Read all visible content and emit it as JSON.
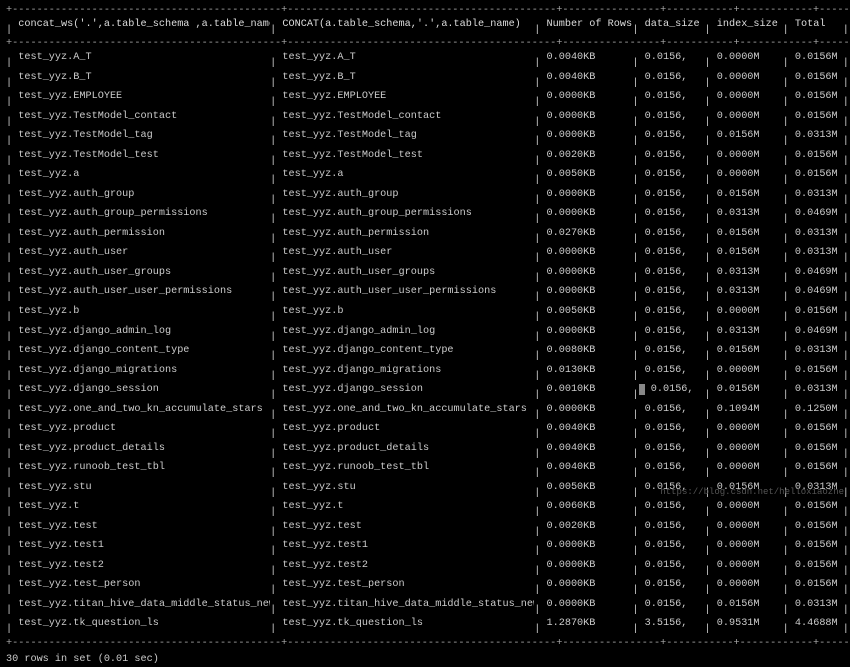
{
  "headers": {
    "col0": "concat_ws('.',a.table_schema ,a.table_name)",
    "col1": "CONCAT(a.table_schema,'.',a.table_name)",
    "col2": "Number of Rows",
    "col3": "data_size",
    "col4": "index_size",
    "col5": "Total"
  },
  "rows": [
    {
      "c0": "test_yyz.A_T",
      "c1": "test_yyz.A_T",
      "c2": "0.0040KB",
      "c3": "0.0156,",
      "c4": "0.0000M",
      "c5": "0.0156M"
    },
    {
      "c0": "test_yyz.B_T",
      "c1": "test_yyz.B_T",
      "c2": "0.0040KB",
      "c3": "0.0156,",
      "c4": "0.0000M",
      "c5": "0.0156M"
    },
    {
      "c0": "test_yyz.EMPLOYEE",
      "c1": "test_yyz.EMPLOYEE",
      "c2": "0.0000KB",
      "c3": "0.0156,",
      "c4": "0.0000M",
      "c5": "0.0156M"
    },
    {
      "c0": "test_yyz.TestModel_contact",
      "c1": "test_yyz.TestModel_contact",
      "c2": "0.0000KB",
      "c3": "0.0156,",
      "c4": "0.0000M",
      "c5": "0.0156M"
    },
    {
      "c0": "test_yyz.TestModel_tag",
      "c1": "test_yyz.TestModel_tag",
      "c2": "0.0000KB",
      "c3": "0.0156,",
      "c4": "0.0156M",
      "c5": "0.0313M"
    },
    {
      "c0": "test_yyz.TestModel_test",
      "c1": "test_yyz.TestModel_test",
      "c2": "0.0020KB",
      "c3": "0.0156,",
      "c4": "0.0000M",
      "c5": "0.0156M"
    },
    {
      "c0": "test_yyz.a",
      "c1": "test_yyz.a",
      "c2": "0.0050KB",
      "c3": "0.0156,",
      "c4": "0.0000M",
      "c5": "0.0156M"
    },
    {
      "c0": "test_yyz.auth_group",
      "c1": "test_yyz.auth_group",
      "c2": "0.0000KB",
      "c3": "0.0156,",
      "c4": "0.0156M",
      "c5": "0.0313M"
    },
    {
      "c0": "test_yyz.auth_group_permissions",
      "c1": "test_yyz.auth_group_permissions",
      "c2": "0.0000KB",
      "c3": "0.0156,",
      "c4": "0.0313M",
      "c5": "0.0469M"
    },
    {
      "c0": "test_yyz.auth_permission",
      "c1": "test_yyz.auth_permission",
      "c2": "0.0270KB",
      "c3": "0.0156,",
      "c4": "0.0156M",
      "c5": "0.0313M"
    },
    {
      "c0": "test_yyz.auth_user",
      "c1": "test_yyz.auth_user",
      "c2": "0.0000KB",
      "c3": "0.0156,",
      "c4": "0.0156M",
      "c5": "0.0313M"
    },
    {
      "c0": "test_yyz.auth_user_groups",
      "c1": "test_yyz.auth_user_groups",
      "c2": "0.0000KB",
      "c3": "0.0156,",
      "c4": "0.0313M",
      "c5": "0.0469M"
    },
    {
      "c0": "test_yyz.auth_user_user_permissions",
      "c1": "test_yyz.auth_user_user_permissions",
      "c2": "0.0000KB",
      "c3": "0.0156,",
      "c4": "0.0313M",
      "c5": "0.0469M"
    },
    {
      "c0": "test_yyz.b",
      "c1": "test_yyz.b",
      "c2": "0.0050KB",
      "c3": "0.0156,",
      "c4": "0.0000M",
      "c5": "0.0156M"
    },
    {
      "c0": "test_yyz.django_admin_log",
      "c1": "test_yyz.django_admin_log",
      "c2": "0.0000KB",
      "c3": "0.0156,",
      "c4": "0.0313M",
      "c5": "0.0469M"
    },
    {
      "c0": "test_yyz.django_content_type",
      "c1": "test_yyz.django_content_type",
      "c2": "0.0080KB",
      "c3": "0.0156,",
      "c4": "0.0156M",
      "c5": "0.0313M"
    },
    {
      "c0": "test_yyz.django_migrations",
      "c1": "test_yyz.django_migrations",
      "c2": "0.0130KB",
      "c3": "0.0156,",
      "c4": "0.0000M",
      "c5": "0.0156M"
    },
    {
      "c0": "test_yyz.django_session",
      "c1": "test_yyz.django_session",
      "c2": "0.0010KB",
      "c3": "0.0156,",
      "c4": "0.0156M",
      "c5": "0.0313M",
      "cursor": true
    },
    {
      "c0": "test_yyz.one_and_two_kn_accumulate_stars",
      "c1": "test_yyz.one_and_two_kn_accumulate_stars",
      "c2": "0.0000KB",
      "c3": "0.0156,",
      "c4": "0.1094M",
      "c5": "0.1250M"
    },
    {
      "c0": "test_yyz.product",
      "c1": "test_yyz.product",
      "c2": "0.0040KB",
      "c3": "0.0156,",
      "c4": "0.0000M",
      "c5": "0.0156M"
    },
    {
      "c0": "test_yyz.product_details",
      "c1": "test_yyz.product_details",
      "c2": "0.0040KB",
      "c3": "0.0156,",
      "c4": "0.0000M",
      "c5": "0.0156M"
    },
    {
      "c0": "test_yyz.runoob_test_tbl",
      "c1": "test_yyz.runoob_test_tbl",
      "c2": "0.0040KB",
      "c3": "0.0156,",
      "c4": "0.0000M",
      "c5": "0.0156M"
    },
    {
      "c0": "test_yyz.stu",
      "c1": "test_yyz.stu",
      "c2": "0.0050KB",
      "c3": "0.0156,",
      "c4": "0.0156M",
      "c5": "0.0313M"
    },
    {
      "c0": "test_yyz.t",
      "c1": "test_yyz.t",
      "c2": "0.0060KB",
      "c3": "0.0156,",
      "c4": "0.0000M",
      "c5": "0.0156M"
    },
    {
      "c0": "test_yyz.test",
      "c1": "test_yyz.test",
      "c2": "0.0020KB",
      "c3": "0.0156,",
      "c4": "0.0000M",
      "c5": "0.0156M"
    },
    {
      "c0": "test_yyz.test1",
      "c1": "test_yyz.test1",
      "c2": "0.0000KB",
      "c3": "0.0156,",
      "c4": "0.0000M",
      "c5": "0.0156M"
    },
    {
      "c0": "test_yyz.test2",
      "c1": "test_yyz.test2",
      "c2": "0.0000KB",
      "c3": "0.0156,",
      "c4": "0.0000M",
      "c5": "0.0156M"
    },
    {
      "c0": "test_yyz.test_person",
      "c1": "test_yyz.test_person",
      "c2": "0.0000KB",
      "c3": "0.0156,",
      "c4": "0.0000M",
      "c5": "0.0156M"
    },
    {
      "c0": "test_yyz.titan_hive_data_middle_status_new",
      "c1": "test_yyz.titan_hive_data_middle_status_new",
      "c2": "0.0000KB",
      "c3": "0.0156,",
      "c4": "0.0156M",
      "c5": "0.0313M"
    },
    {
      "c0": "test_yyz.tk_question_ls",
      "c1": "test_yyz.tk_question_ls",
      "c2": "1.2870KB",
      "c3": "3.5156,",
      "c4": "0.9531M",
      "c5": "4.4688M"
    }
  ],
  "status": "30 rows in set (0.01 sec)",
  "watermark": "https://blog.csdn.net/helloxiaozhe"
}
